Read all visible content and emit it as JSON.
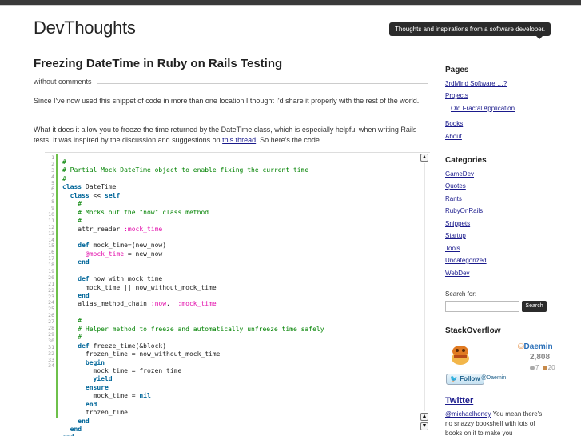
{
  "header": {
    "site_title": "DevThoughts",
    "tagline": "Thoughts and inspirations from a software developer."
  },
  "post": {
    "title": "Freezing DateTime in Ruby on Rails Testing",
    "meta": "without comments",
    "para1": "Since I've now used this snippet of code in more than one location I thought I'd share it properly with the rest of the world.",
    "para2_before": "What it does it allow you to freeze the time returned by the DateTime class, which is especially helpful when writing Rails tests. It was inspired by the discussion and suggestions on ",
    "para2_link": "this thread",
    "para2_after": ". So here's the code."
  },
  "code": {
    "line_numbers": [
      "1",
      "2",
      "3",
      "4",
      "5",
      "6",
      "7",
      "8",
      "9",
      "10",
      "11",
      "12",
      "13",
      "14",
      "15",
      "16",
      "17",
      "18",
      "19",
      "20",
      "21",
      "22",
      "23",
      "24",
      "25",
      "26",
      "27",
      "28",
      "29",
      "30",
      "31",
      "32",
      "33",
      "34"
    ],
    "lines": [
      [
        [
          "c",
          "#"
        ]
      ],
      [
        [
          "c",
          "# Partial Mock DateTime object to enable fixing the current time"
        ]
      ],
      [
        [
          "c",
          "#"
        ]
      ],
      [
        [
          "k",
          "class"
        ],
        [
          "n",
          " DateTime"
        ]
      ],
      [
        [
          "n",
          "  "
        ],
        [
          "k",
          "class"
        ],
        [
          "n",
          " << "
        ],
        [
          "k",
          "self"
        ]
      ],
      [
        [
          "n",
          "    "
        ],
        [
          "c",
          "#"
        ]
      ],
      [
        [
          "n",
          "    "
        ],
        [
          "c",
          "# Mocks out the \"now\" class method"
        ]
      ],
      [
        [
          "n",
          "    "
        ],
        [
          "c",
          "#"
        ]
      ],
      [
        [
          "n",
          "    attr_reader "
        ],
        [
          "s",
          ":mock_time"
        ]
      ],
      [
        [
          "n",
          ""
        ]
      ],
      [
        [
          "n",
          "    "
        ],
        [
          "k",
          "def"
        ],
        [
          "n",
          " mock_time=(new_now)"
        ]
      ],
      [
        [
          "n",
          "      "
        ],
        [
          "s",
          "@mock_time"
        ],
        [
          "n",
          " = new_now"
        ]
      ],
      [
        [
          "n",
          "    "
        ],
        [
          "k",
          "end"
        ]
      ],
      [
        [
          "n",
          ""
        ]
      ],
      [
        [
          "n",
          "    "
        ],
        [
          "k",
          "def"
        ],
        [
          "n",
          " now_with_mock_time"
        ]
      ],
      [
        [
          "n",
          "      mock_time || now_without_mock_time"
        ]
      ],
      [
        [
          "n",
          "    "
        ],
        [
          "k",
          "end"
        ]
      ],
      [
        [
          "n",
          "    alias_method_chain "
        ],
        [
          "s",
          ":now"
        ],
        [
          "n",
          ",  "
        ],
        [
          "s",
          ":mock_time"
        ]
      ],
      [
        [
          "n",
          ""
        ]
      ],
      [
        [
          "n",
          "    "
        ],
        [
          "c",
          "#"
        ]
      ],
      [
        [
          "n",
          "    "
        ],
        [
          "c",
          "# Helper method to freeze and automatically unfreeze time safely"
        ]
      ],
      [
        [
          "n",
          "    "
        ],
        [
          "c",
          "#"
        ]
      ],
      [
        [
          "n",
          "    "
        ],
        [
          "k",
          "def"
        ],
        [
          "n",
          " freeze_time(&block)"
        ]
      ],
      [
        [
          "n",
          "      frozen_time = now_without_mock_time"
        ]
      ],
      [
        [
          "n",
          "      "
        ],
        [
          "k",
          "begin"
        ]
      ],
      [
        [
          "n",
          "        mock_time = frozen_time"
        ]
      ],
      [
        [
          "n",
          "        "
        ],
        [
          "k",
          "yield"
        ]
      ],
      [
        [
          "n",
          "      "
        ],
        [
          "k",
          "ensure"
        ]
      ],
      [
        [
          "n",
          "        mock_time = "
        ],
        [
          "k",
          "nil"
        ]
      ],
      [
        [
          "n",
          "      "
        ],
        [
          "k",
          "end"
        ]
      ],
      [
        [
          "n",
          "      frozen_time"
        ]
      ],
      [
        [
          "n",
          "    "
        ],
        [
          "k",
          "end"
        ]
      ],
      [
        [
          "n",
          "  "
        ],
        [
          "k",
          "end"
        ]
      ],
      [
        [
          "k",
          "end"
        ]
      ]
    ]
  },
  "sidebar": {
    "pages_heading": "Pages",
    "pages": [
      "3rdMind Software …?",
      "Projects",
      "Old Fractal Application",
      "Books",
      "About"
    ],
    "categories_heading": "Categories",
    "categories": [
      "GameDev",
      "Quotes",
      "Rants",
      "RubyOnRails",
      "Snippets",
      "Startup",
      "Tools",
      "Uncategorized",
      "WebDev"
    ],
    "search_label": "Search for:",
    "search_value": "",
    "search_button": "Search",
    "stackoverflow_heading": "StackOverflow",
    "so_user": "Daemin",
    "so_reputation": "2,808",
    "so_silver": "7",
    "so_bronze": "20",
    "follow_label": "Follow",
    "follow_handle": "@Daemin",
    "twitter_heading": "Twitter",
    "tweet_user": "@michaelhoney",
    "tweet_text": " You mean there's no snazzy bookshelf with lots of books on it to make you"
  },
  "colors": {
    "comment": "#008200",
    "keyword": "#006699",
    "symbol": "#e30dab",
    "gutter_bar": "#6ec04b",
    "link": "#1a1a8c"
  }
}
